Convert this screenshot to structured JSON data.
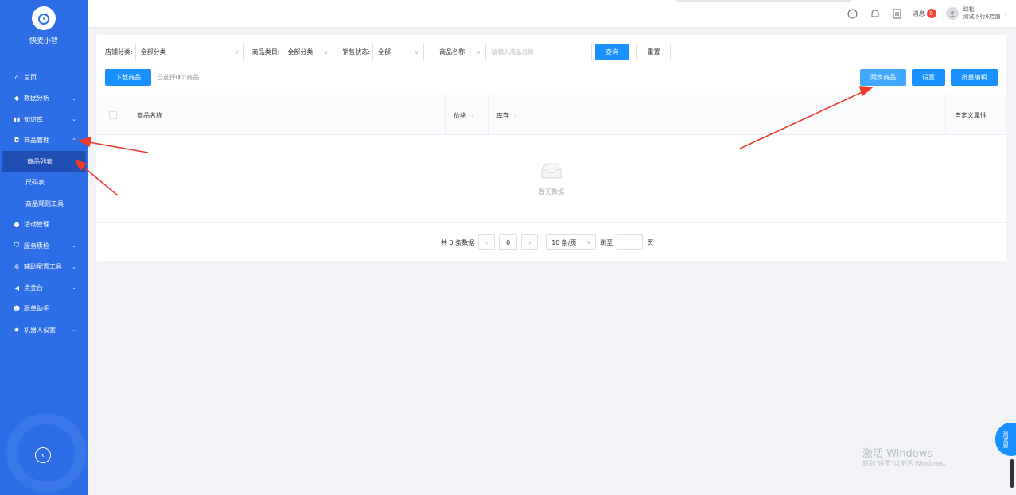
{
  "sidebar": {
    "app_title": "快麦小智",
    "items": [
      {
        "label": "首页",
        "icon": "home-icon",
        "has_chevron": false
      },
      {
        "label": "数据分析",
        "icon": "chart-icon",
        "has_chevron": true
      },
      {
        "label": "知识库",
        "icon": "book-icon",
        "has_chevron": true
      },
      {
        "label": "商品管理",
        "icon": "bag-icon",
        "has_chevron": true,
        "expanded": true
      },
      {
        "label": "商品列表",
        "sub": true,
        "active": true
      },
      {
        "label": "尺码表",
        "sub": true
      },
      {
        "label": "商品规则工具",
        "sub": true
      },
      {
        "label": "活动管理",
        "icon": "activity-icon",
        "has_chevron": false
      },
      {
        "label": "服务质检",
        "icon": "shield-icon",
        "has_chevron": true
      },
      {
        "label": "辅助配置工具",
        "icon": "tools-icon",
        "has_chevron": true
      },
      {
        "label": "点金台",
        "icon": "send-icon",
        "has_chevron": true
      },
      {
        "label": "跟单助手",
        "icon": "user-icon",
        "has_chevron": false
      },
      {
        "label": "机器人设置",
        "icon": "gear-icon",
        "has_chevron": true
      }
    ]
  },
  "header": {
    "msg_label": "消息",
    "msg_count": "0",
    "user_name": "球松",
    "shop_name": "测试下行6店铺"
  },
  "filters": {
    "shop_cat_label": "店铺分类:",
    "shop_cat_value": "全部分类",
    "goods_cat_label": "商品类目:",
    "goods_cat_value": "全部分类",
    "sale_status_label": "销售状态:",
    "sale_status_value": "全部",
    "search_field": "商品名称",
    "search_placeholder": "请输入商品名称",
    "query_btn": "查询",
    "reset_btn": "重置"
  },
  "toolbar": {
    "download_btn": "下载商品",
    "selected_info_prefix": "已选择",
    "selected_count": "0",
    "selected_info_suffix": "个商品",
    "sync_btn": "同步商品",
    "settings_btn": "设置",
    "batch_edit_btn": "批量编辑"
  },
  "table": {
    "columns": {
      "name": "商品名称",
      "price": "价格",
      "stock": "库存",
      "custom": "自定义属性"
    },
    "empty_text": "暂无数据"
  },
  "pagination": {
    "total_prefix": "共",
    "total": "0",
    "total_suffix": "条数据",
    "current_page": "0",
    "page_size": "10 条/页",
    "jump_label": "跳至",
    "page_label": "页"
  },
  "watermark": {
    "line1": "激活 Windows",
    "line2": "转到\"设置\"以激活 Windows。"
  },
  "float_button": {
    "label": "测试窗"
  },
  "colors": {
    "sidebar": "#2d6ee6",
    "primary": "#1890ff",
    "annotation_arrow": "#f03a2a"
  }
}
